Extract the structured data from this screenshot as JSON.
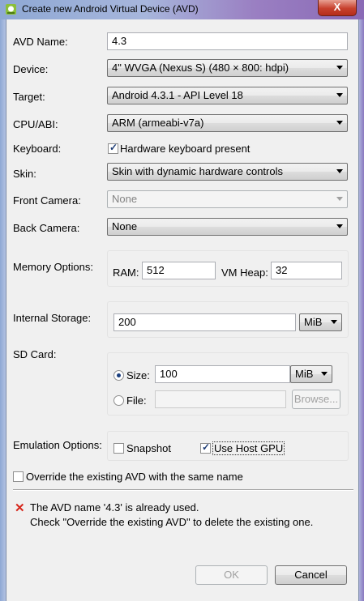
{
  "window": {
    "title": "Create new Android Virtual Device (AVD)",
    "close_label": "X"
  },
  "form": {
    "avd_name": {
      "label": "AVD Name:",
      "value": "4.3"
    },
    "device": {
      "label": "Device:",
      "value": "4\" WVGA (Nexus S) (480 × 800: hdpi)"
    },
    "target": {
      "label": "Target:",
      "value": "Android 4.3.1 - API Level 18"
    },
    "cpu_abi": {
      "label": "CPU/ABI:",
      "value": "ARM (armeabi-v7a)"
    },
    "keyboard": {
      "label": "Keyboard:",
      "checkbox_label": "Hardware keyboard present",
      "checked": true
    },
    "skin": {
      "label": "Skin:",
      "value": "Skin with dynamic hardware controls"
    },
    "front_camera": {
      "label": "Front Camera:",
      "value": "None",
      "disabled": true
    },
    "back_camera": {
      "label": "Back Camera:",
      "value": "None"
    },
    "memory": {
      "label": "Memory Options:",
      "ram_label": "RAM:",
      "ram_value": "512",
      "vm_heap_label": "VM Heap:",
      "vm_heap_value": "32"
    },
    "internal_storage": {
      "label": "Internal Storage:",
      "value": "200",
      "unit": "MiB"
    },
    "sd_card": {
      "label": "SD Card:",
      "size_label": "Size:",
      "size_value": "100",
      "size_unit": "MiB",
      "file_label": "File:",
      "file_value": "",
      "browse_label": "Browse...",
      "selected": "size"
    },
    "emulation": {
      "label": "Emulation Options:",
      "snapshot_label": "Snapshot",
      "snapshot_checked": false,
      "host_gpu_label": "Use Host GPU",
      "host_gpu_checked": true
    },
    "override": {
      "label": "Override the existing AVD with the same name",
      "checked": false
    }
  },
  "error": {
    "icon": "error-x-icon",
    "line1": "The AVD name '4.3' is already used.",
    "line2": "Check \"Override the existing AVD\" to delete the existing one."
  },
  "buttons": {
    "ok": "OK",
    "cancel": "Cancel"
  },
  "colors": {
    "error": "#d6261b",
    "disabled_text": "#a0a0a0"
  }
}
